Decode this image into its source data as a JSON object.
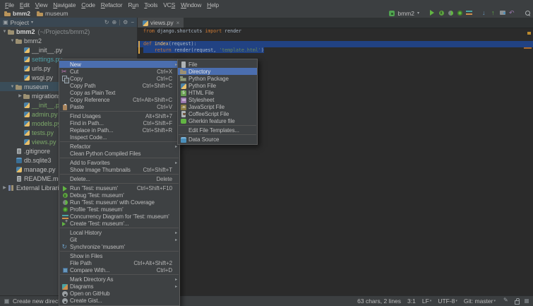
{
  "menubar": {
    "items": [
      {
        "label": "File",
        "m": 0
      },
      {
        "label": "Edit",
        "m": 0
      },
      {
        "label": "View",
        "m": 0
      },
      {
        "label": "Navigate",
        "m": 0
      },
      {
        "label": "Code",
        "m": 0
      },
      {
        "label": "Refactor",
        "m": 0
      },
      {
        "label": "Run",
        "m": 1
      },
      {
        "label": "Tools",
        "m": 0
      },
      {
        "label": "VCS",
        "m": 2
      },
      {
        "label": "Window",
        "m": 0
      },
      {
        "label": "Help",
        "m": 0
      }
    ]
  },
  "breadcrumbs": {
    "items": [
      {
        "label": "bmm2",
        "bold": true
      },
      {
        "label": "museum",
        "bold": false
      }
    ]
  },
  "toolbar": {
    "run_config": "bmm2",
    "left_icons": [
      "django"
    ],
    "chevron": "▾",
    "action_icons": [
      "run",
      "debug",
      "coverage",
      "profile",
      "concurrency"
    ],
    "vcs_icons": [
      "vcs-update",
      "vcs-commit",
      "shelf",
      "undo"
    ],
    "search_icon": "search"
  },
  "project_panel": {
    "title": "Project",
    "title_chevron": "▾",
    "header_icons": [
      {
        "name": "sync-icon",
        "glyph": "↻"
      },
      {
        "name": "locate-icon",
        "glyph": "⊕"
      },
      {
        "name": "divider",
        "glyph": ""
      },
      {
        "name": "settings-icon",
        "glyph": "⚙"
      },
      {
        "name": "hide-icon",
        "glyph": "−"
      }
    ],
    "tree": [
      {
        "level": 0,
        "arrow": "down",
        "icon": "folder",
        "label": "bmm2",
        "note": "(~/Projects/bmm2)",
        "bold": true
      },
      {
        "level": 1,
        "arrow": "down",
        "icon": "folder",
        "label": "bmm2"
      },
      {
        "level": 2,
        "icon": "python",
        "label": "__init__.py"
      },
      {
        "level": 2,
        "icon": "python",
        "label": "settings.py",
        "color": "modified"
      },
      {
        "level": 2,
        "icon": "python",
        "label": "urls.py"
      },
      {
        "level": 2,
        "icon": "python",
        "label": "wsgi.py"
      },
      {
        "level": 1,
        "arrow": "down",
        "icon": "folder",
        "label": "museum",
        "selected": true
      },
      {
        "level": 2,
        "arrow": "right",
        "icon": "folder",
        "label": "migrations"
      },
      {
        "level": 2,
        "icon": "python",
        "label": "__init__.py",
        "color": "added"
      },
      {
        "level": 2,
        "icon": "python",
        "label": "admin.py",
        "color": "added"
      },
      {
        "level": 2,
        "icon": "python",
        "label": "models.py",
        "color": "added"
      },
      {
        "level": 2,
        "icon": "python",
        "label": "tests.py",
        "color": "added"
      },
      {
        "level": 2,
        "icon": "python",
        "label": "views.py",
        "color": "added"
      },
      {
        "level": 1,
        "icon": "text-file",
        "label": ".gitignore"
      },
      {
        "level": 1,
        "icon": "database",
        "label": "db.sqlite3"
      },
      {
        "level": 1,
        "icon": "python",
        "label": "manage.py"
      },
      {
        "level": 1,
        "icon": "text-file",
        "label": "README.md"
      },
      {
        "level": 0,
        "arrow": "right",
        "icon": "library",
        "label": "External Libraries"
      }
    ],
    "colors": {
      "default": "#BDBDBD",
      "modified": "#4FA0A8",
      "added": "#7CA869"
    }
  },
  "editor": {
    "tab": {
      "label": "views.py",
      "close": "×"
    },
    "lines": [
      {
        "tokens": [
          [
            "kw",
            "from "
          ],
          [
            "pl",
            "django.shortcuts "
          ],
          [
            "kw",
            "import"
          ],
          [
            "pl",
            " render"
          ]
        ],
        "selection": "none"
      },
      {
        "tokens": [],
        "selection": "none"
      },
      {
        "tokens": [
          [
            "kw",
            "def "
          ],
          [
            "fn",
            "index"
          ],
          [
            "pl",
            "(request):"
          ]
        ],
        "selection": "full"
      },
      {
        "tokens": [
          [
            "pl",
            "    "
          ],
          [
            "kw",
            "return "
          ],
          [
            "pl",
            "render(request, "
          ],
          [
            "str",
            "'template.html'"
          ],
          [
            "pl",
            ")"
          ]
        ],
        "selection": "text"
      }
    ]
  },
  "context_menu": {
    "items": [
      {
        "label": "New",
        "submenu": true,
        "highlighted": true
      },
      {
        "label": "Cut",
        "shortcut": "Ctrl+X",
        "icon": "scissors"
      },
      {
        "label": "Copy",
        "shortcut": "Ctrl+C",
        "icon": "copy"
      },
      {
        "label": "Copy Path",
        "shortcut": "Ctrl+Shift+C"
      },
      {
        "label": "Copy as Plain Text"
      },
      {
        "label": "Copy Reference",
        "shortcut": "Ctrl+Alt+Shift+C"
      },
      {
        "label": "Paste",
        "shortcut": "Ctrl+V",
        "icon": "paste"
      },
      {
        "sep": true
      },
      {
        "label": "Find Usages",
        "shortcut": "Alt+Shift+7"
      },
      {
        "label": "Find in Path...",
        "shortcut": "Ctrl+Shift+F"
      },
      {
        "label": "Replace in Path...",
        "shortcut": "Ctrl+Shift+R"
      },
      {
        "label": "Inspect Code..."
      },
      {
        "sep": true
      },
      {
        "label": "Refactor",
        "submenu": true
      },
      {
        "label": "Clean Python Compiled Files"
      },
      {
        "sep": true
      },
      {
        "label": "Add to Favorites",
        "submenu": true
      },
      {
        "label": "Show Image Thumbnails",
        "shortcut": "Ctrl+Shift+T"
      },
      {
        "sep": true
      },
      {
        "label": "Delete...",
        "shortcut": "Delete"
      },
      {
        "sep": true
      },
      {
        "label": "Run 'Test: museum'",
        "shortcut": "Ctrl+Shift+F10",
        "icon": "run"
      },
      {
        "label": "Debug 'Test: museum'",
        "icon": "debug"
      },
      {
        "label": "Run 'Test: museum' with Coverage",
        "icon": "coverage"
      },
      {
        "label": "Profile 'Test: museum'",
        "icon": "profile"
      },
      {
        "label": "Concurrency Diagram for 'Test: museum'",
        "icon": "concurrency"
      },
      {
        "label": "Create 'Test: museum'...",
        "icon": "create-run"
      },
      {
        "sep": true
      },
      {
        "label": "Local History",
        "submenu": true
      },
      {
        "label": "Git",
        "submenu": true
      },
      {
        "label": "Synchronize 'museum'",
        "icon": "sync"
      },
      {
        "sep": true
      },
      {
        "label": "Show in Files"
      },
      {
        "label": "File Path",
        "shortcut": "Ctrl+Alt+Shift+2"
      },
      {
        "label": "Compare With...",
        "shortcut": "Ctrl+D",
        "icon": "compare"
      },
      {
        "sep": true
      },
      {
        "label": "Mark Directory As",
        "submenu": true
      },
      {
        "label": "Diagrams",
        "submenu": true,
        "icon": "diagrams"
      },
      {
        "label": "Open on GitHub",
        "icon": "github"
      },
      {
        "label": "Create Gist...",
        "icon": "github"
      }
    ]
  },
  "new_submenu": {
    "items": [
      {
        "label": "File",
        "icon": "file"
      },
      {
        "label": "Directory",
        "icon": "folder",
        "highlighted": true
      },
      {
        "label": "Python Package",
        "icon": "package"
      },
      {
        "label": "Python File",
        "icon": "python"
      },
      {
        "label": "HTML File",
        "icon": "html"
      },
      {
        "label": "Stylesheet",
        "icon": "stylesheet"
      },
      {
        "label": "JavaScript File",
        "icon": "javascript"
      },
      {
        "label": "CoffeeScript File",
        "icon": "coffeescript"
      },
      {
        "label": "Gherkin feature file",
        "icon": "gherkin"
      },
      {
        "sep": true
      },
      {
        "label": "Edit File Templates..."
      },
      {
        "sep": true
      },
      {
        "label": "Data Source",
        "icon": "datasource"
      }
    ]
  },
  "status_bar": {
    "message": "Create new directory",
    "segments": [
      {
        "text": "63 chars, 2 lines",
        "chevron": false
      },
      {
        "text": "3:1",
        "chevron": false
      },
      {
        "text": "LF",
        "chevron": true
      },
      {
        "text": "UTF-8",
        "chevron": true
      },
      {
        "text": "Git: master",
        "chevron": true
      }
    ],
    "icons": [
      "pen",
      "lock",
      "theme"
    ]
  }
}
